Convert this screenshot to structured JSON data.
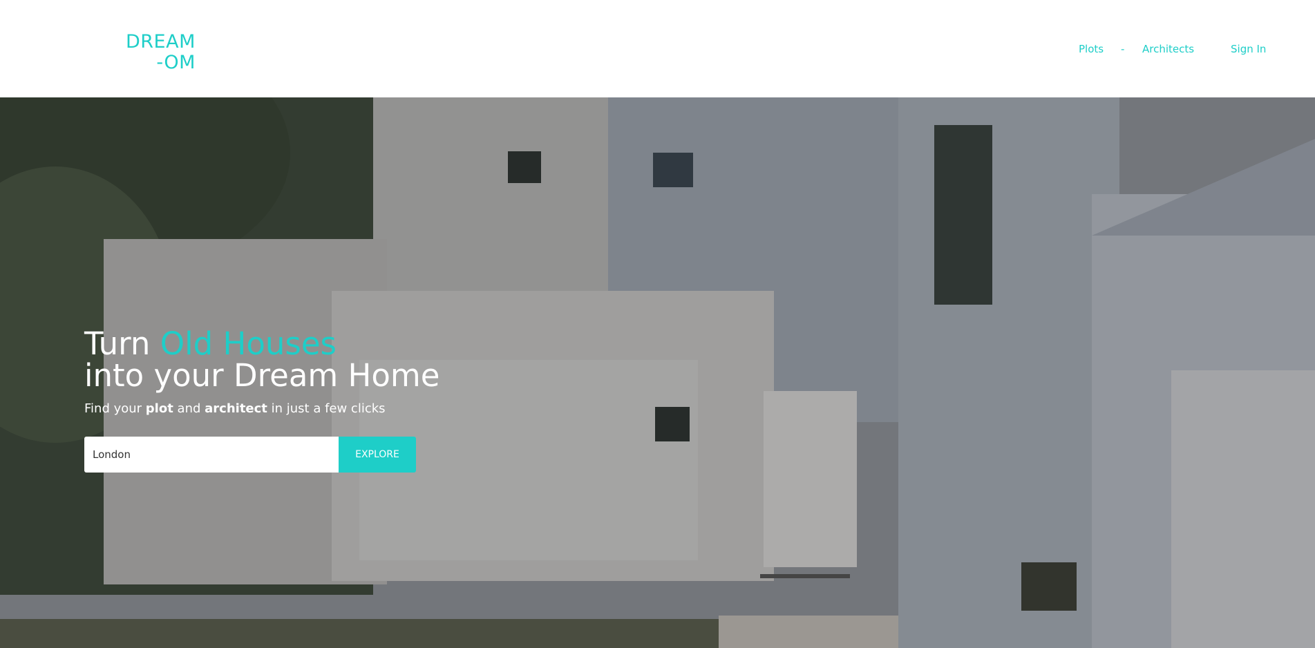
{
  "logo": {
    "line1": "DREAM",
    "line2": "-OM"
  },
  "nav": {
    "plots": "Plots",
    "separator": "-",
    "architects": "Architects",
    "sign_in": "Sign In"
  },
  "hero": {
    "headline_part1": "Turn ",
    "headline_accent": "Old Houses",
    "headline_line2": "into your Dream Home",
    "sub_part1": "Find your ",
    "sub_bold1": "plot",
    "sub_part2": " and ",
    "sub_bold2": "architect",
    "sub_part3": " in just a few clicks",
    "search_value": "London",
    "explore_label": "EXPLORE"
  },
  "colors": {
    "accent": "#1ecec8",
    "header_bg": "#ffffff",
    "text_on_hero": "#ffffff"
  }
}
